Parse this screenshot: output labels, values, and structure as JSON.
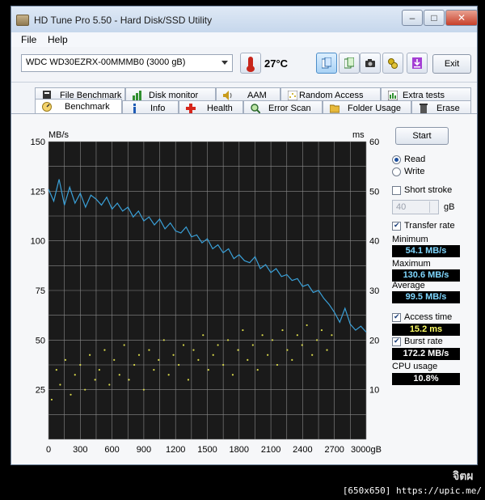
{
  "window": {
    "title": "HD Tune Pro 5.50 - Hard Disk/SSD Utility",
    "minimize_glyph": "–",
    "maximize_glyph": "□",
    "close_glyph": "✕"
  },
  "menu": {
    "file": "File",
    "help": "Help"
  },
  "toolbar": {
    "drive": "WDC WD30EZRX-00MMMB0 (3000 gB)",
    "temperature": "27°C",
    "exit_label": "Exit",
    "icons": [
      "copy-icon",
      "copy-text-icon",
      "camera-icon",
      "settings-icon",
      "download-icon"
    ]
  },
  "tabs": {
    "row1": [
      "File Benchmark",
      "Disk monitor",
      "AAM",
      "Random Access",
      "Extra tests"
    ],
    "row2": [
      "Benchmark",
      "Info",
      "Health",
      "Error Scan",
      "Folder Usage",
      "Erase"
    ],
    "active": "Benchmark"
  },
  "side": {
    "start_label": "Start",
    "read_label": "Read",
    "write_label": "Write",
    "mode": "Read",
    "short_stroke_label": "Short stroke",
    "short_stroke_checked": false,
    "short_stroke_value": "40",
    "short_stroke_unit": "gB",
    "transfer_rate_label": "Transfer rate",
    "transfer_rate_checked": true,
    "minimum_label": "Minimum",
    "minimum_value": "54.1 MB/s",
    "maximum_label": "Maximum",
    "maximum_value": "130.6 MB/s",
    "average_label": "Average",
    "average_value": "99.5 MB/s",
    "access_time_label": "Access time",
    "access_time_checked": true,
    "access_time_value": "15.2 ms",
    "burst_rate_label": "Burst rate",
    "burst_rate_checked": true,
    "burst_rate_value": "172.2 MB/s",
    "cpu_label": "CPU usage",
    "cpu_value": "10.8%"
  },
  "colors": {
    "transfer_line": "#3aa0d8",
    "access_points": "#d8d84a",
    "plot_background": "#1a1a1a",
    "grid": "#8a8a8a"
  },
  "chart_data": {
    "type": "line",
    "ylabel_left": "MB/s",
    "ylabel_right": "ms",
    "x_ticks": [
      "0",
      "300",
      "600",
      "900",
      "1200",
      "1500",
      "1800",
      "2100",
      "2400",
      "2700",
      "3000gB"
    ],
    "y_ticks_left": [
      "150",
      "125",
      "100",
      "75",
      "50",
      "25"
    ],
    "y_ticks_right": [
      "60",
      "50",
      "40",
      "30",
      "20",
      "10"
    ],
    "xlim": [
      0,
      3000
    ],
    "ylim_left": [
      0,
      150
    ],
    "ylim_right": [
      0,
      60
    ],
    "grid": true,
    "series": [
      {
        "unit": "MB/s",
        "x": [
          0,
          50,
          100,
          150,
          200,
          250,
          300,
          350,
          400,
          450,
          500,
          550,
          600,
          650,
          700,
          750,
          800,
          850,
          900,
          950,
          1000,
          1050,
          1100,
          1150,
          1200,
          1250,
          1300,
          1350,
          1400,
          1450,
          1500,
          1550,
          1600,
          1650,
          1700,
          1750,
          1800,
          1850,
          1900,
          1950,
          2000,
          2050,
          2100,
          2150,
          2200,
          2250,
          2300,
          2350,
          2400,
          2450,
          2500,
          2550,
          2600,
          2650,
          2700,
          2750,
          2800,
          2850,
          2900,
          2950,
          3000
        ],
        "values": [
          126,
          120,
          131,
          118,
          127,
          119,
          124,
          117,
          123,
          121,
          118,
          122,
          116,
          119,
          115,
          117,
          112,
          115,
          110,
          112,
          108,
          111,
          106,
          109,
          105,
          104,
          107,
          102,
          103,
          99,
          101,
          96,
          98,
          94,
          96,
          91,
          93,
          90,
          89,
          92,
          86,
          88,
          84,
          86,
          82,
          83,
          80,
          81,
          77,
          78,
          74,
          75,
          71,
          68,
          64,
          59,
          66,
          58,
          55,
          57,
          54
        ]
      },
      {
        "unit": "ms",
        "type": "scatter",
        "x": [
          30,
          75,
          110,
          160,
          210,
          250,
          300,
          345,
          390,
          440,
          480,
          530,
          575,
          620,
          670,
          715,
          760,
          810,
          855,
          900,
          950,
          995,
          1040,
          1090,
          1135,
          1180,
          1230,
          1275,
          1320,
          1370,
          1415,
          1460,
          1510,
          1555,
          1600,
          1650,
          1695,
          1740,
          1790,
          1835,
          1880,
          1930,
          1975,
          2020,
          2070,
          2115,
          2160,
          2210,
          2255,
          2300,
          2350,
          2395,
          2440,
          2490,
          2535,
          2580,
          2630,
          2675
        ],
        "values": [
          8,
          14,
          11,
          16,
          9,
          13,
          15,
          10,
          17,
          12,
          14,
          18,
          11,
          16,
          13,
          19,
          12,
          15,
          17,
          10,
          18,
          14,
          16,
          20,
          13,
          17,
          15,
          19,
          12,
          18,
          16,
          21,
          14,
          17,
          19,
          15,
          20,
          13,
          18,
          22,
          16,
          19,
          14,
          21,
          17,
          20,
          15,
          22,
          18,
          16,
          21,
          19,
          23,
          17,
          20,
          22,
          18,
          21
        ]
      }
    ]
  },
  "footer": {
    "upic": "[650x650] https://upic.me/",
    "watermark": "จิตผ"
  }
}
